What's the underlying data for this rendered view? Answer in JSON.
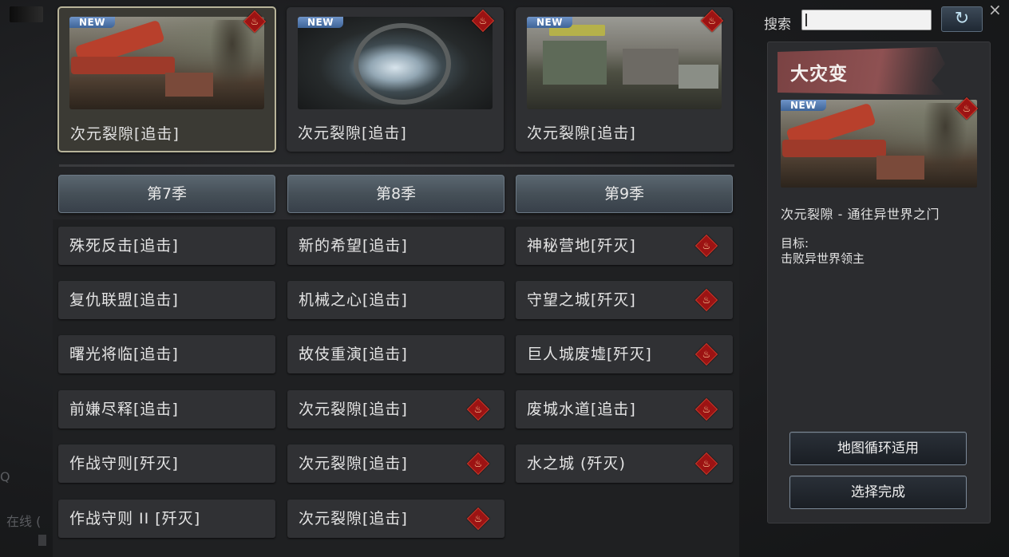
{
  "search": {
    "label": "搜索",
    "value": ""
  },
  "window": {
    "close_glyph": "×",
    "refresh_glyph": "↻"
  },
  "featured_maps": [
    {
      "name": "次元裂隙[追击]",
      "badge": "NEW",
      "thumb": "red-structure-ruins",
      "selected": true
    },
    {
      "name": "次元裂隙[追击]",
      "badge": "NEW",
      "thumb": "ring-portal-tunnel",
      "selected": false
    },
    {
      "name": "次元裂隙[追击]",
      "badge": "NEW",
      "thumb": "ruined-street",
      "selected": false
    }
  ],
  "seasons": [
    {
      "label": "第7季"
    },
    {
      "label": "第8季"
    },
    {
      "label": "第9季"
    }
  ],
  "map_lists": [
    {
      "season": "第7季",
      "items": [
        {
          "name": "殊死反击[追击]",
          "hazard": false
        },
        {
          "name": "复仇联盟[追击]",
          "hazard": false
        },
        {
          "name": "曙光将临[追击]",
          "hazard": false
        },
        {
          "name": "前嫌尽释[追击]",
          "hazard": false
        },
        {
          "name": "作战守则[歼灭]",
          "hazard": false
        },
        {
          "name": "作战守则 II [歼灭]",
          "hazard": false
        }
      ]
    },
    {
      "season": "第8季",
      "items": [
        {
          "name": "新的希望[追击]",
          "hazard": false
        },
        {
          "name": "机械之心[追击]",
          "hazard": false
        },
        {
          "name": "故伎重演[追击]",
          "hazard": false
        },
        {
          "name": "次元裂隙[追击]",
          "hazard": true
        },
        {
          "name": "次元裂隙[追击]",
          "hazard": true
        },
        {
          "name": "次元裂隙[追击]",
          "hazard": true
        }
      ]
    },
    {
      "season": "第9季",
      "items": [
        {
          "name": "神秘营地[歼灭]",
          "hazard": true
        },
        {
          "name": "守望之城[歼灭]",
          "hazard": true
        },
        {
          "name": "巨人城废墟[歼灭]",
          "hazard": true
        },
        {
          "name": "废城水道[追击]",
          "hazard": true
        },
        {
          "name": "水之城 (歼灭)",
          "hazard": true
        }
      ]
    }
  ],
  "detail": {
    "category": "大灾变",
    "badge": "NEW",
    "map_name": "次元裂隙 - 通往异世界之门",
    "objective_label": "目标:",
    "objective_text": "击败异世界领主",
    "loop_button": "地图循环适用",
    "confirm_button": "选择完成"
  },
  "background_fragments": {
    "online": "在线 (",
    "q": "Q"
  },
  "colors": {
    "hazard": "#9c1313",
    "new_badge": "#4f77b0",
    "selected_border": "#b8b49a",
    "banner": "#8a4c4d"
  },
  "icons": {
    "hazard": "flame-hazard-icon",
    "refresh": "refresh-icon",
    "close": "close-icon",
    "new": "new-badge"
  }
}
